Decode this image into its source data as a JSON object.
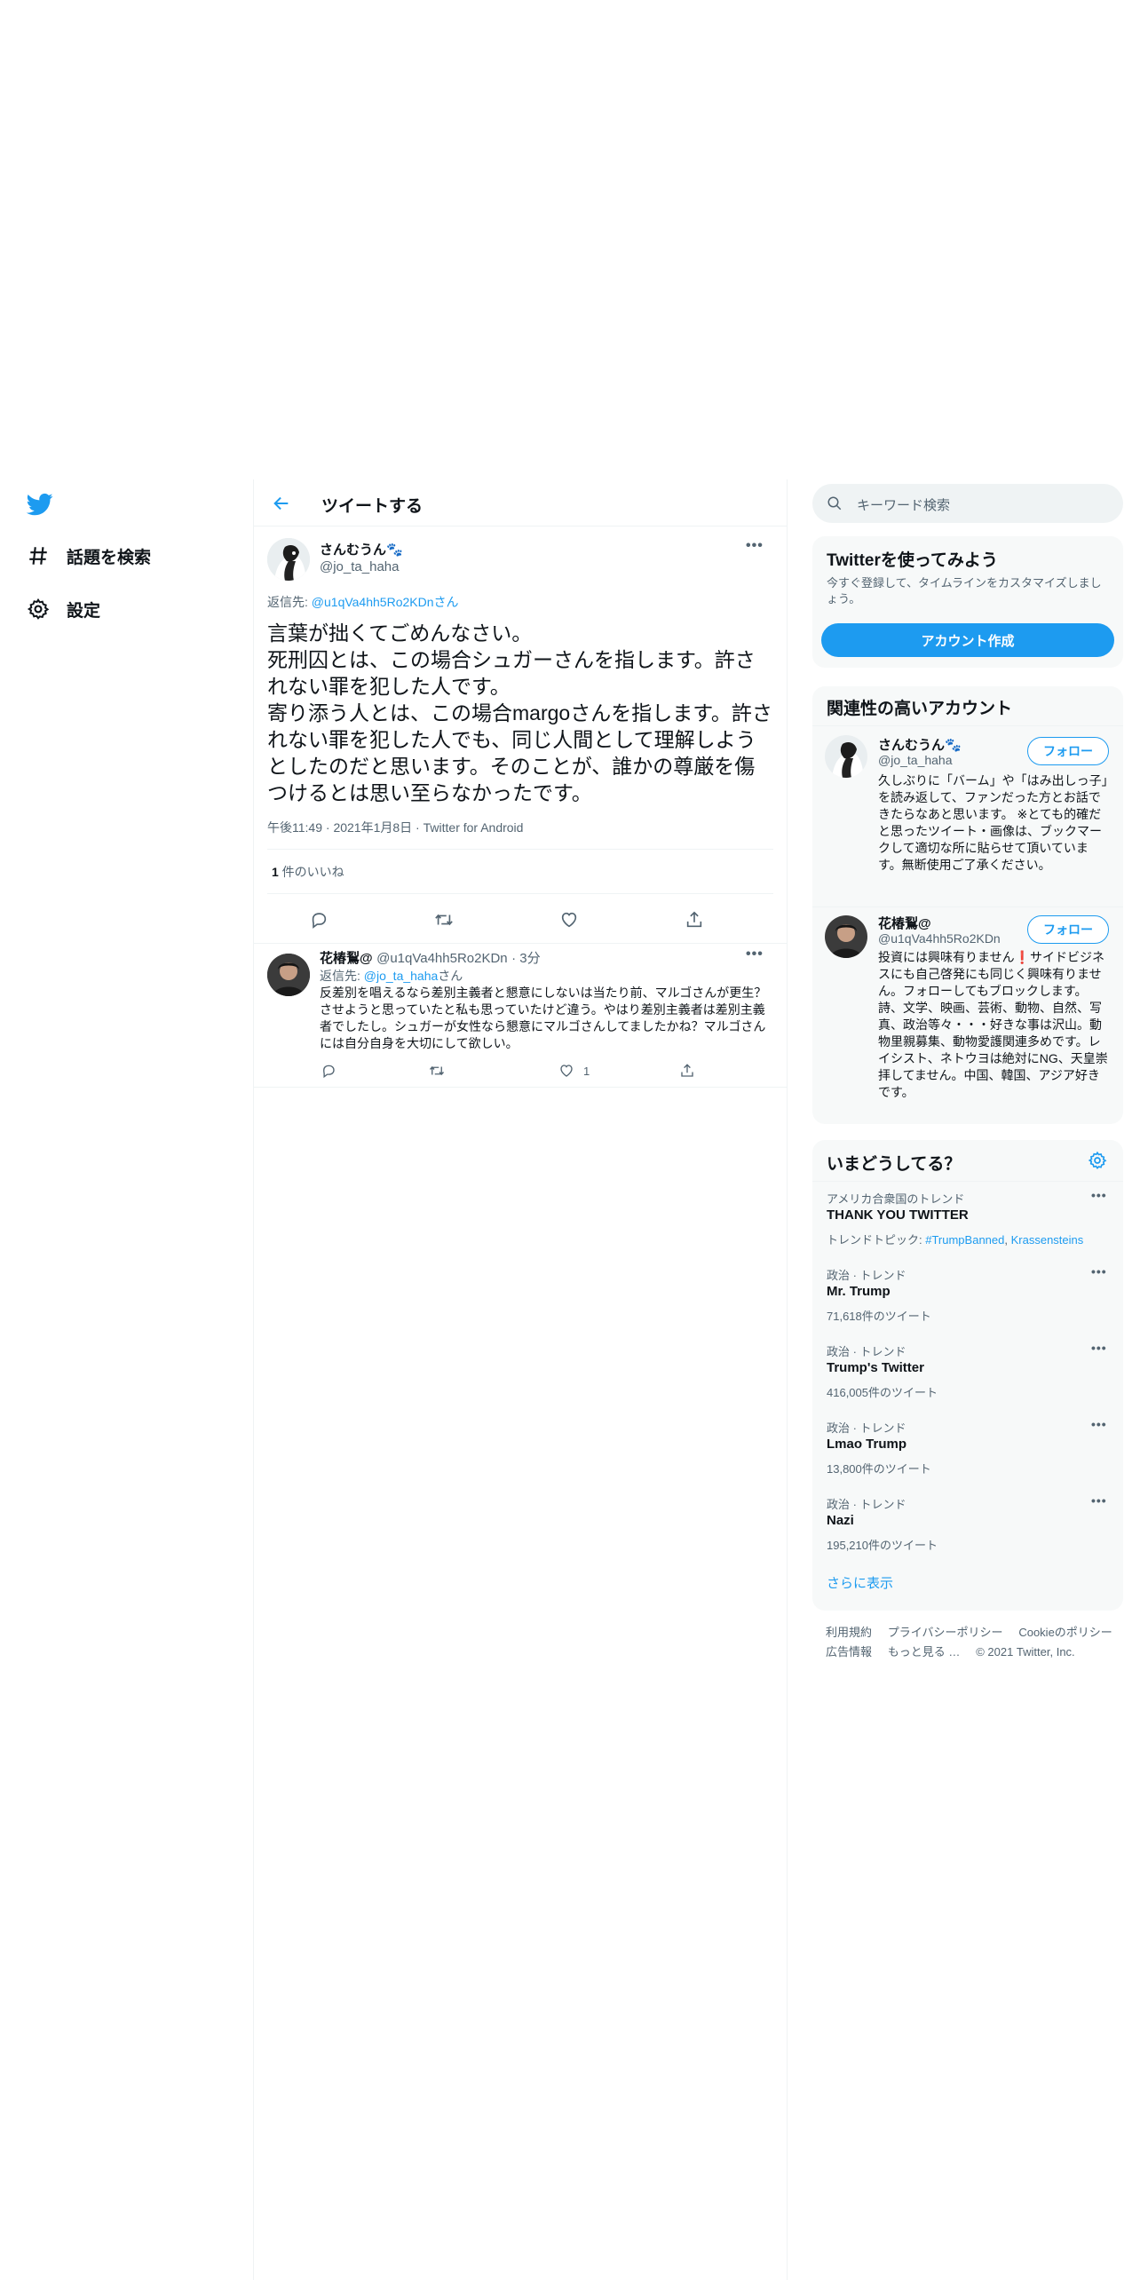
{
  "sidebar": {
    "items": [
      {
        "label": "話題を検索",
        "icon": "hashtag-icon"
      },
      {
        "label": "設定",
        "icon": "gear-icon"
      }
    ]
  },
  "header": {
    "title": "ツイートする"
  },
  "tweet": {
    "name": "さんむうん🐾",
    "handle": "@jo_ta_haha",
    "reply_prefix": "返信先: ",
    "reply_to": "@u1qVa4hh5Ro2KDn",
    "reply_suffix": "さん",
    "text": "言葉が拙くてごめんなさい。\n死刑囚とは、この場合シュガーさんを指します。許されない罪を犯した人です。\n寄り添う人とは、この場合margoさんを指します。許されない罪を犯した人でも、同じ人間として理解しようとしたのだと思います。そのことが、誰かの尊厳を傷つけるとは思い至らなかったです。",
    "time": "午後11:49",
    "date": "2021年1月8日",
    "source": "Twitter for Android",
    "likes_count": "1",
    "likes_label": " 件のいいね"
  },
  "reply": {
    "name": "花椿鴷@",
    "handle": "@u1qVa4hh5Ro2KDn",
    "time": "3分",
    "reply_prefix": "返信先: ",
    "reply_to": "@jo_ta_haha",
    "reply_suffix": "さん",
    "text": "反差別を唱えるなら差別主義者と懇意にしないは当たり前、マルゴさんが更生？させようと思っていたと私も思っていたけど違う。やはり差別主義者は差別主義者でしたし。シュガーが女性なら懇意にマルゴさんしてましたかね？マルゴさんには自分自身を大切にして欲しい。",
    "like_count": "1"
  },
  "search": {
    "placeholder": "キーワード検索"
  },
  "signup": {
    "title": "Twitterを使ってみよう",
    "desc": "今すぐ登録して、タイムラインをカスタマイズしましょう。",
    "button": "アカウント作成"
  },
  "related": {
    "title": "関連性の高いアカウント",
    "accounts": [
      {
        "name": "さんむうん🐾",
        "handle": "@jo_ta_haha",
        "follow": "フォロー",
        "bio": "久しぶりに「バーム」や「はみ出しっ子」を読み返して、ファンだった方とお話できたらなあと思います。 ※とても的確だと思ったツイート・画像は、ブックマークして適切な所に貼らせて頂いています。無断使用ご了承ください。"
      },
      {
        "name": "花椿鴷@",
        "handle": "@u1qVa4hh5Ro2KDn",
        "follow": "フォロー",
        "bio": "投資には興味有りません❗サイドビジネスにも自己啓発にも同じく興味有りません。フォローしてもブロックします。詩、文学、映画、芸術、動物、自然、写真、政治等々・・・好きな事は沢山。動物里親募集、動物愛護関連多めです。レイシスト、ネトウヨは絶対にNG、天皇崇拝してません。中国、韓国、アジア好きです。"
      }
    ]
  },
  "trends": {
    "title": "いまどうしてる？",
    "items": [
      {
        "context": "アメリカ合衆国のトレンド",
        "name": "THANK YOU TWITTER",
        "topics_label": "トレンドトピック: ",
        "topics": [
          "#TrumpBanned",
          "Krassensteins"
        ]
      },
      {
        "context": "政治 · トレンド",
        "name": "Mr. Trump",
        "count": "71,618件のツイート"
      },
      {
        "context": "政治 · トレンド",
        "name": "Trump's Twitter",
        "count": "416,005件のツイート"
      },
      {
        "context": "政治 · トレンド",
        "name": "Lmao Trump",
        "count": "13,800件のツイート"
      },
      {
        "context": "政治 · トレンド",
        "name": "Nazi",
        "count": "195,210件のツイート"
      }
    ],
    "show_more": "さらに表示"
  },
  "footer": {
    "links": [
      "利用規約",
      "プライバシーポリシー",
      "Cookieのポリシー",
      "広告情報",
      "もっと見る …"
    ],
    "copyright": "© 2021 Twitter, Inc."
  },
  "colors": {
    "accent": "#1d9bf0",
    "text": "#0f1419",
    "secondary": "#536471",
    "border": "#eff3f4"
  }
}
